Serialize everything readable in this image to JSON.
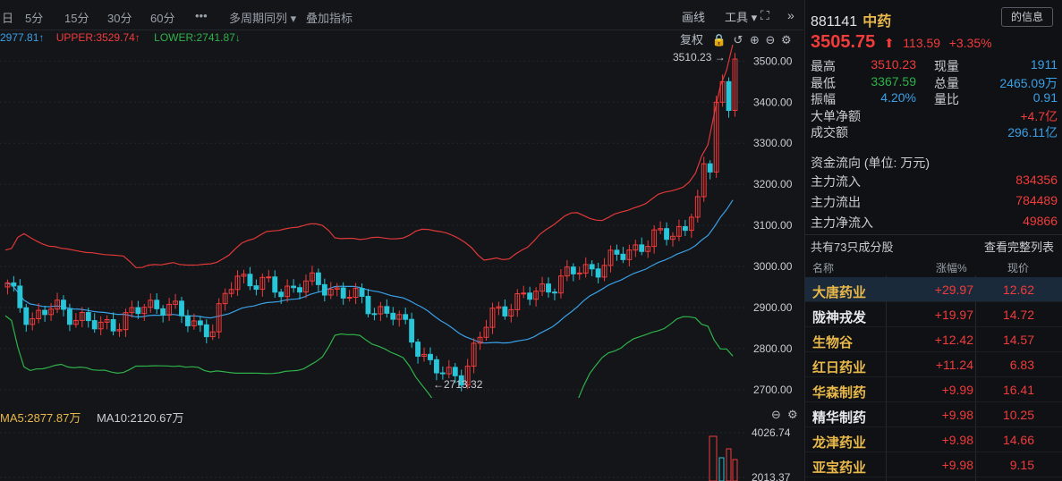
{
  "toolbar": {
    "periods": [
      "日",
      "5分",
      "15分",
      "30分",
      "60分",
      "•••",
      "多周期同列",
      "叠加指标"
    ],
    "right_labels": [
      "画线",
      "工具"
    ]
  },
  "boll_legend": {
    "mid": "2977.81↑",
    "upper": "UPPER:3529.74↑",
    "lower": "LOWER:2741.87↓"
  },
  "chart_controls": {
    "reset_label": "复权"
  },
  "main_chart": {
    "type": "candlestick",
    "y_ticks": [
      "3500.00",
      "3400.00",
      "3300.00",
      "3200.00",
      "3100.00",
      "3000.00",
      "2900.00",
      "2800.00",
      "2700.00"
    ],
    "ylim": [
      2680,
      3540
    ],
    "high_label": "3510.23",
    "low_label": "2713.32",
    "colors": {
      "up": "#f23b3b",
      "down": "#29c5d8",
      "mid": "#3aa0e6",
      "upper": "#e03838",
      "lower": "#2fb24a"
    }
  },
  "volume": {
    "ma5": "MA5:2877.87万",
    "ma10": "MA10:2120.67万",
    "y_ticks": [
      "4026.74",
      "2013.37"
    ]
  },
  "quote": {
    "code": "881141",
    "name": "中药",
    "chip": "的信息",
    "price": "3505.75",
    "arrow": "⬆",
    "change": "113.59",
    "change_pct": "+3.35%",
    "stats": [
      {
        "l1": "最高",
        "v1": "3510.23",
        "c1": "#f23b3b",
        "l2": "现量",
        "v2": "1911",
        "c2": "#3aa0e6"
      },
      {
        "l1": "最低",
        "v1": "3367.59",
        "c1": "#2fb24a",
        "l2": "总量",
        "v2": "2465.09万",
        "c2": "#3aa0e6"
      },
      {
        "l1": "振幅",
        "v1": "4.20%",
        "c1": "#3aa0e6",
        "l2": "量比",
        "v2": "0.91",
        "c2": "#3aa0e6"
      }
    ],
    "big_order_label": "大单净额",
    "big_order_value": "+4.7亿",
    "turnover_label": "成交额",
    "turnover_value": "296.11亿"
  },
  "flow": {
    "title": "资金流向 (单位: 万元)",
    "rows": [
      {
        "label": "主力流入",
        "value": "834356"
      },
      {
        "label": "主力流出",
        "value": "784489"
      },
      {
        "label": "主力净流入",
        "value": "49866"
      }
    ]
  },
  "constituents": {
    "count_label": "共有73只成分股",
    "button": "查看完整列表",
    "headers": {
      "name": "名称",
      "pct": "涨幅%",
      "price": "现价"
    },
    "rows": [
      {
        "name": "大唐药业",
        "pct": "+29.97",
        "price": "12.62",
        "color": "#e8b84a"
      },
      {
        "name": "陇神戎发",
        "pct": "+19.97",
        "price": "14.72",
        "color": "#e6e8ec"
      },
      {
        "name": "生物谷",
        "pct": "+12.42",
        "price": "14.57",
        "color": "#e8b84a"
      },
      {
        "name": "红日药业",
        "pct": "+11.24",
        "price": "6.83",
        "color": "#e8b84a"
      },
      {
        "name": "华森制药",
        "pct": "+9.99",
        "price": "16.41",
        "color": "#e8b84a"
      },
      {
        "name": "精华制药",
        "pct": "+9.98",
        "price": "10.25",
        "color": "#e6e8ec"
      },
      {
        "name": "龙津药业",
        "pct": "+9.98",
        "price": "14.66",
        "color": "#e8b84a"
      },
      {
        "name": "亚宝药业",
        "pct": "+9.98",
        "price": "9.15",
        "color": "#e8b84a"
      }
    ]
  }
}
